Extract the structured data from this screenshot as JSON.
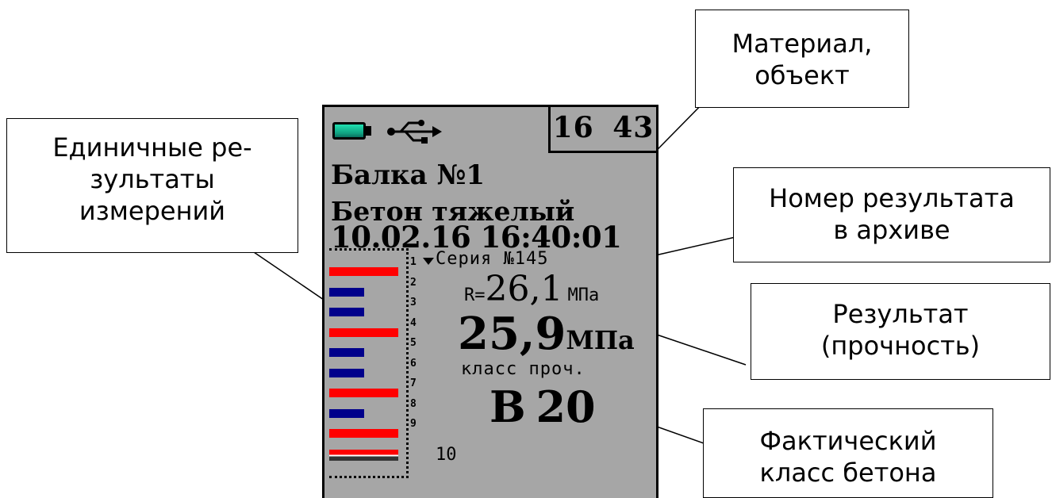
{
  "device": {
    "clock": "16 43",
    "object": "Балка №1",
    "material": "Бетон тяжелый",
    "datetime": "10.02.16 16:40:01",
    "series": "Серия №145",
    "r_label": "R=",
    "r_value": "26,1",
    "r_unit": "МПа",
    "strength_value": "25,9",
    "strength_unit": "МПа",
    "class_label": "класс проч.",
    "class_value": "B 20",
    "icons": {
      "battery": "battery-icon",
      "usb": "usb-icon",
      "series_marker": "triangle-down-icon"
    },
    "colors": {
      "screen": "#a6a6a6",
      "bar_high": "#ff0000",
      "bar_low": "#00008b"
    }
  },
  "measurements": [
    {
      "num": "1",
      "level": 0.95,
      "color": "#ff0000"
    },
    {
      "num": "2",
      "level": 0.48,
      "color": "#00008b"
    },
    {
      "num": "3",
      "level": 0.48,
      "color": "#00008b"
    },
    {
      "num": "4",
      "level": 0.95,
      "color": "#ff0000"
    },
    {
      "num": "5",
      "level": 0.48,
      "color": "#00008b"
    },
    {
      "num": "6",
      "level": 0.48,
      "color": "#00008b"
    },
    {
      "num": "7",
      "level": 0.95,
      "color": "#ff0000"
    },
    {
      "num": "8",
      "level": 0.48,
      "color": "#00008b"
    },
    {
      "num": "9",
      "level": 0.95,
      "color": "#ff0000"
    },
    {
      "num": "10",
      "level": 0.95,
      "color": "#ff0000"
    }
  ],
  "callouts": {
    "material": "Материал,\nобъект",
    "single_results": "Единичные ре-\nзультаты\nизмерений",
    "archive_number": "Номер результата\nв архиве",
    "result": "Результат\n(прочность)",
    "actual_class": "Фактический\nкласс бетона"
  }
}
